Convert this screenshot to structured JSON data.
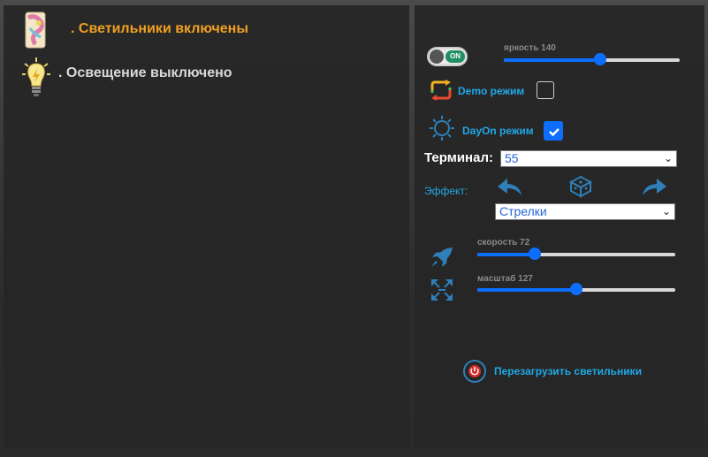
{
  "status": {
    "lights_on_text": ". Светильники включены",
    "lighting_off_text": ". Освещение выключено",
    "lights_on_color": "#f0a020",
    "lighting_off_color": "#d9d9d9"
  },
  "controls": {
    "power_toggle_label": "ON",
    "brightness_label": "яркость 140",
    "brightness_fraction": 0.55,
    "demo_mode_label": "Demo режим",
    "demo_mode_checked": false,
    "dayon_mode_label": "DayOn режим",
    "dayon_mode_checked": true,
    "terminal_label": "Терминал:",
    "terminal_value": "55",
    "effect_label": "Эффект:",
    "effect_value": "Стрелки",
    "speed_label": "скорость 72",
    "speed_fraction": 0.29,
    "scale_label": "масштаб 127",
    "scale_fraction": 0.5,
    "reboot_label": "Перезагрузить светильники"
  },
  "icons": {
    "lamp": "lamp-icon",
    "bulb": "lightbulb-icon",
    "demo": "refresh-icon",
    "dayon": "sun-moon-icon",
    "prev": "arrow-left-icon",
    "random": "dice-icon",
    "next": "arrow-right-icon",
    "speed": "rocket-icon",
    "scale": "expand-icon",
    "reboot": "power-icon"
  },
  "colors": {
    "accent": "#0d6efd",
    "cyan": "#1fa9e6",
    "orange": "#f0a020"
  }
}
